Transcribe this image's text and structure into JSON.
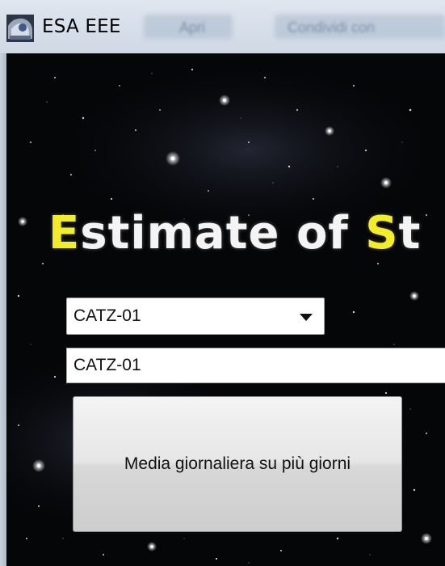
{
  "window": {
    "title": "ESA EEE",
    "app_icon": "app-logo-icon",
    "background_tabs": [
      "Apri",
      "Condividi con"
    ]
  },
  "main": {
    "headline_parts": [
      "E",
      "stimate of ",
      "S",
      "t"
    ],
    "headline_highlight_color": "#f2ec2a",
    "station_select": {
      "value": "CATZ-01",
      "icon": "chevron-down-icon"
    },
    "station_field": {
      "value": "CATZ-01"
    },
    "daily_average_button": {
      "label": "Media giornaliera su più giorni"
    }
  }
}
